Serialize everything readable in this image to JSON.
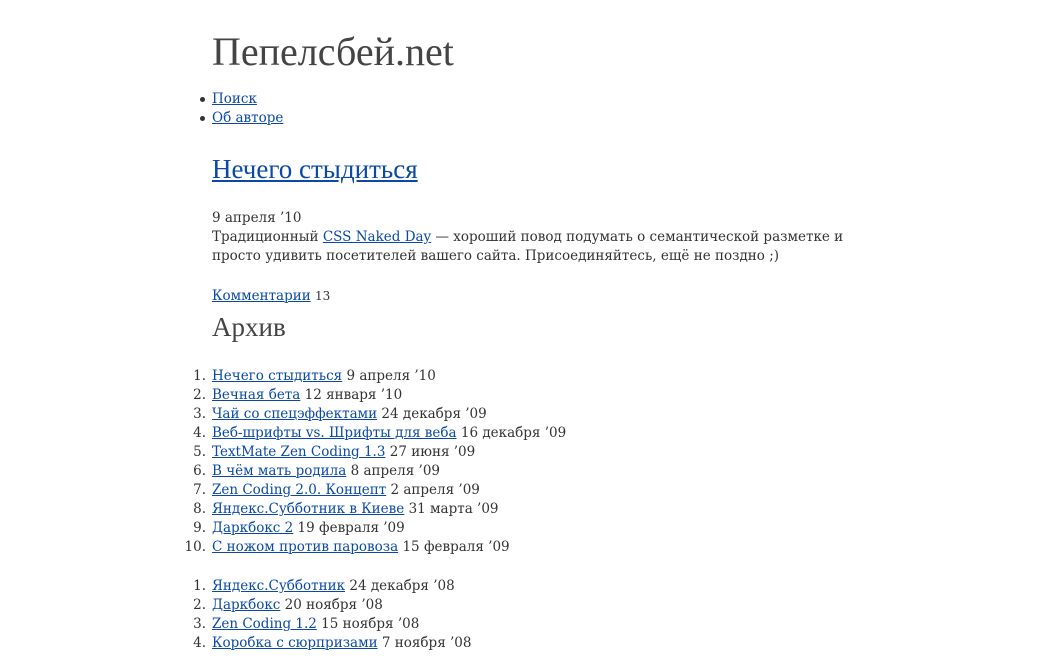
{
  "site": {
    "title": "Пепелсбей.net"
  },
  "nav": [
    {
      "label": "Поиск"
    },
    {
      "label": "Об авторе"
    }
  ],
  "post": {
    "title": "Нечего стыдиться",
    "date": "9 апреля ’10",
    "body_before": "Традиционный ",
    "link_text": "CSS Naked Day",
    "body_after": " — хороший повод подумать о семантической разметке и просто удивить посетителей вашего сайта. Присоединяйтесь, ещё не поздно ;)",
    "comments_label": "Комментарии",
    "comments_count": "13"
  },
  "archive": {
    "title": "Архив",
    "groups": [
      [
        {
          "num": "1.",
          "title": "Нечего стыдиться",
          "date": "9 апреля ’10"
        },
        {
          "num": "2.",
          "title": "Вечная бета",
          "date": "12 января ’10"
        },
        {
          "num": "3.",
          "title": "Чай со спецэффектами",
          "date": "24 декабря ’09"
        },
        {
          "num": "4.",
          "title": "Веб-шрифты vs. Шрифты для веба",
          "date": "16 декабря ’09"
        },
        {
          "num": "5.",
          "title": "TextMate Zen Coding 1.3",
          "date": "27 июня ’09"
        },
        {
          "num": "6.",
          "title": "В чём мать родила",
          "date": "8 апреля ’09"
        },
        {
          "num": "7.",
          "title": "Zen Coding 2.0. Концепт",
          "date": "2 апреля ’09"
        },
        {
          "num": "8.",
          "title": "Яндекс.Субботник в Киеве",
          "date": "31 марта ’09"
        },
        {
          "num": "9.",
          "title": "Даркбокс 2",
          "date": "19 февраля ’09"
        },
        {
          "num": "10.",
          "title": "С ножом против паровоза",
          "date": "15 февраля ’09"
        }
      ],
      [
        {
          "num": "1.",
          "title": "Яндекс.Субботник",
          "date": "24 декабря ’08"
        },
        {
          "num": "2.",
          "title": "Даркбокс",
          "date": "20 ноября ’08"
        },
        {
          "num": "3.",
          "title": "Zen Coding 1.2",
          "date": "15 ноября ’08"
        },
        {
          "num": "4.",
          "title": "Коробка с сюрпризами",
          "date": "7 ноября ’08"
        }
      ]
    ]
  },
  "colors": {
    "link": "#0b49a8",
    "text": "#333333",
    "background": "#ffffff"
  }
}
